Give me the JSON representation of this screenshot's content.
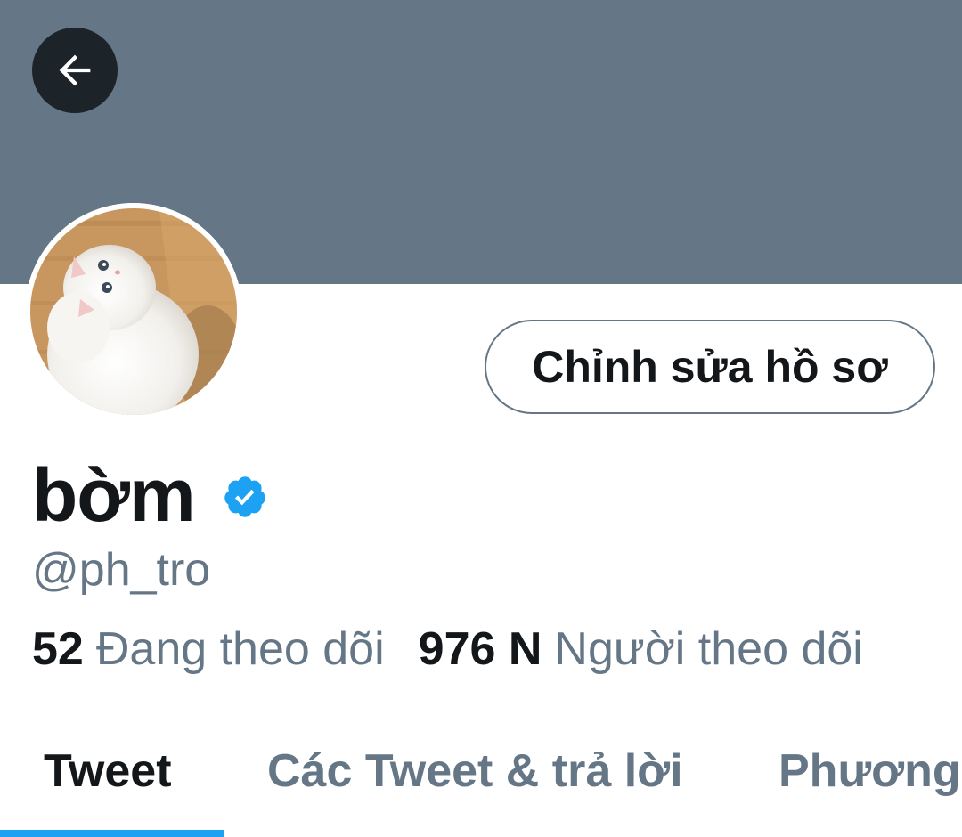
{
  "header": {
    "back_icon": "arrow-left-icon",
    "banner_color": "#657786"
  },
  "profile": {
    "avatar_icon": "avatar-white-cat",
    "edit_button_label": "Chỉnh sửa hồ sơ",
    "display_name": "bờm",
    "verified_icon": "verified-badge-icon",
    "verified_color": "#1da1f2",
    "handle": "@ph_tro"
  },
  "stats": {
    "following_count": "52",
    "following_label": "Đang theo dõi",
    "followers_count": "976 N",
    "followers_label": "Người theo dõi"
  },
  "tabs": [
    {
      "label": "Tweet",
      "active": true
    },
    {
      "label": "Các Tweet & trả lời",
      "active": false
    },
    {
      "label": "Phương",
      "active": false
    }
  ],
  "colors": {
    "text_primary": "#14171a",
    "text_secondary": "#657786",
    "accent": "#1da1f2"
  }
}
